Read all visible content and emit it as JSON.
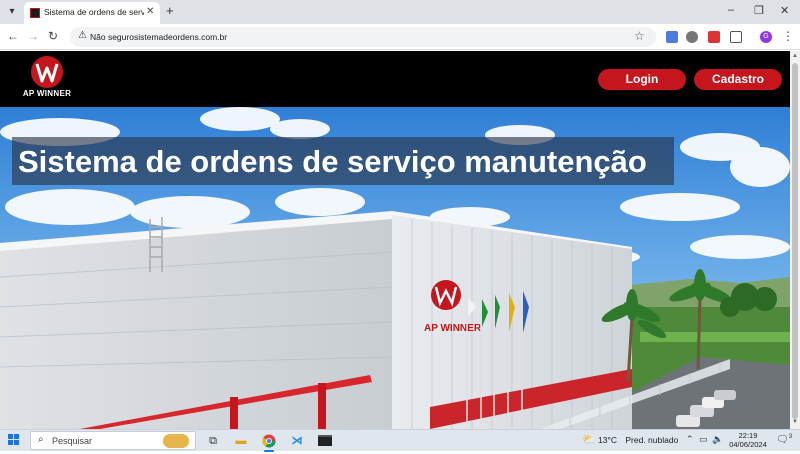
{
  "browser": {
    "tab": {
      "title": "Sistema de ordens de serviço"
    },
    "address_bar": {
      "security_label": "Não seguro",
      "url": "sistemadeordens.com.br"
    }
  },
  "site": {
    "logo_text": "AP WINNER",
    "nav": {
      "login_label": "Login",
      "signup_label": "Cadastro"
    },
    "hero": {
      "title": "Sistema de ordens de serviço manutenção",
      "building_sign": "AP WINNER"
    }
  },
  "taskbar": {
    "search_placeholder": "Pesquisar",
    "weather": {
      "temperature": "13°C",
      "condition": "Pred. nublado"
    },
    "clock": {
      "time": "22:19",
      "date": "04/06/2024"
    },
    "notification_count": "3"
  },
  "colors": {
    "brand_red": "#c4161c",
    "header_bg": "#000000"
  }
}
